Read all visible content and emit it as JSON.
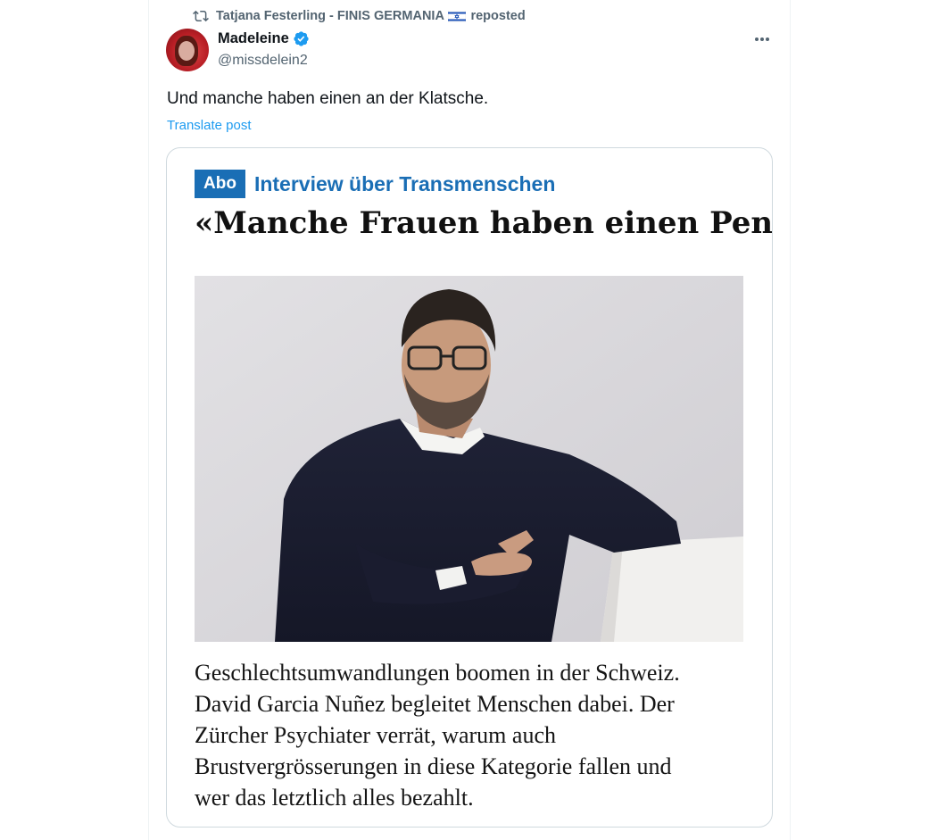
{
  "repost": {
    "user": "Tatjana Festerling - FINIS GERMANIA",
    "suffix": "reposted"
  },
  "author": {
    "name": "Madeleine",
    "handle": "@missdelein2",
    "verified": true
  },
  "post": {
    "text": "Und manche haben einen an der Klatsche.",
    "translate_label": "Translate post"
  },
  "card": {
    "badge": "Abo",
    "kicker": "Interview über Transmenschen",
    "headline": "«Manche Frauen haben einen Penis»",
    "lede_lines": [
      "Geschlechtsumwandlungen boomen in der Schweiz.",
      "David Garcia Nuñez begleitet Menschen dabei. Der",
      "Zürcher Psychiater verrät, warum auch",
      "Brustvergrösserungen in diese Kategorie fallen und",
      "wer das letztlich alles bezahlt."
    ]
  },
  "colors": {
    "link_blue": "#1d9bf0",
    "secondary_text": "#536471",
    "brand_blue": "#1a6eb5"
  },
  "icons": {
    "repost": "repost-icon",
    "flag": "israel-flag-icon",
    "verified": "verified-badge-icon",
    "more": "more-options-icon"
  }
}
